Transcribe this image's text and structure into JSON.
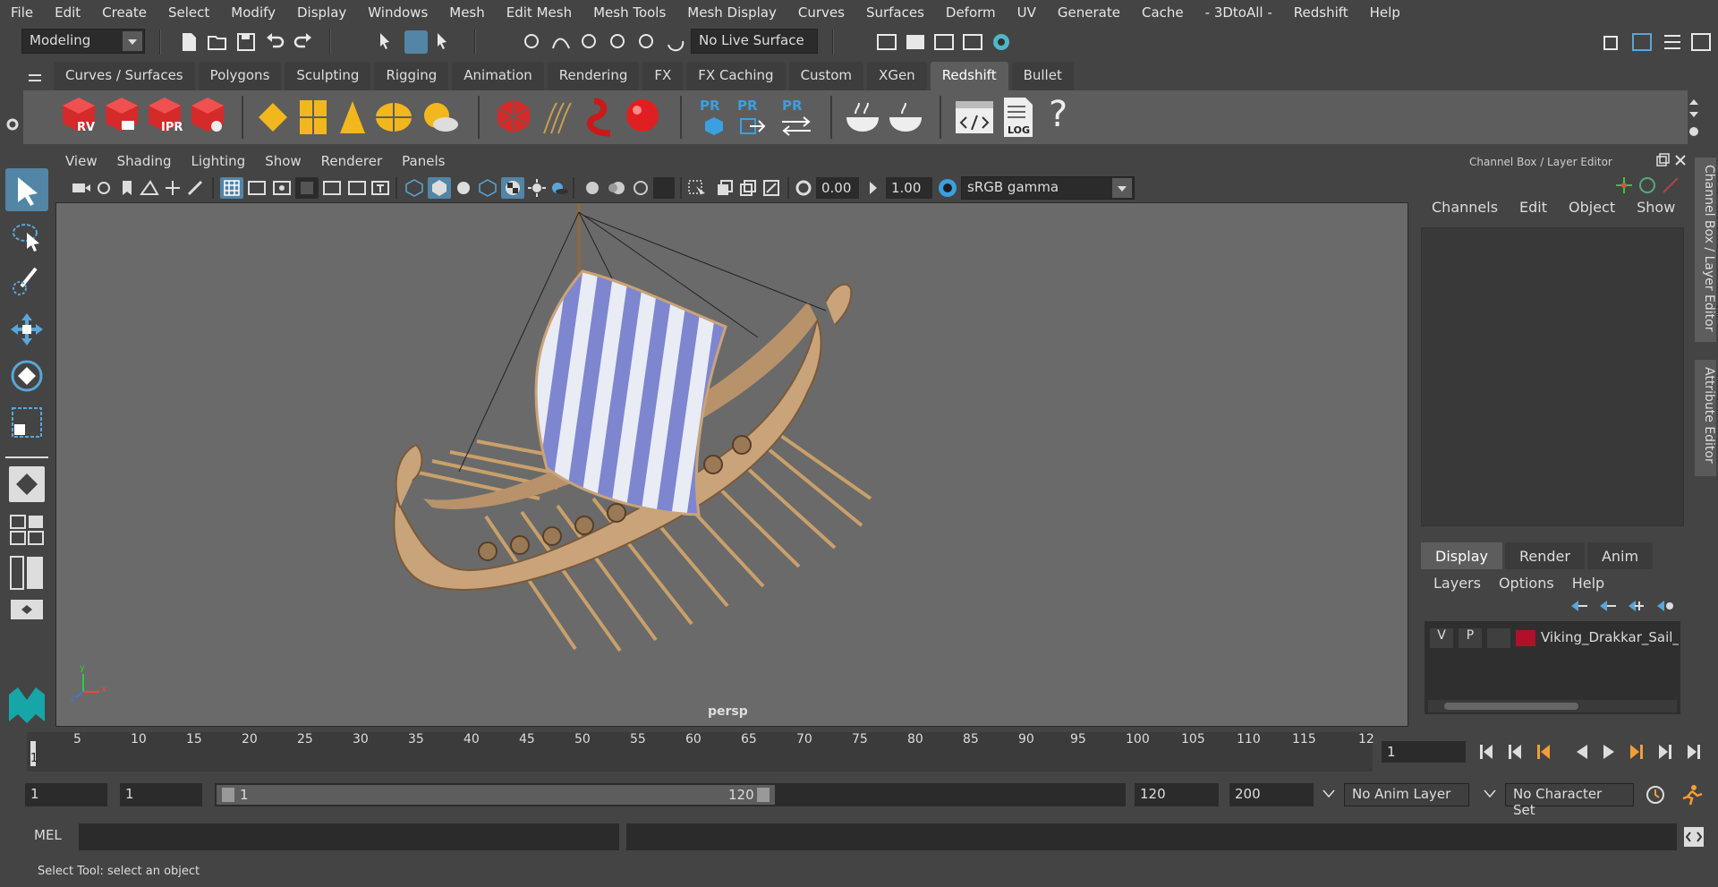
{
  "menubar": [
    "File",
    "Edit",
    "Create",
    "Select",
    "Modify",
    "Display",
    "Windows",
    "Mesh",
    "Edit Mesh",
    "Mesh Tools",
    "Mesh Display",
    "Curves",
    "Surfaces",
    "Deform",
    "UV",
    "Generate",
    "Cache",
    "- 3DtoAll -",
    "Redshift",
    "Help"
  ],
  "toolbar": {
    "mode": "Modeling",
    "live_surface": "No Live Surface"
  },
  "shelf_tabs": [
    "Curves / Surfaces",
    "Polygons",
    "Sculpting",
    "Rigging",
    "Animation",
    "Rendering",
    "FX",
    "FX Caching",
    "Custom",
    "XGen",
    "Redshift",
    "Bullet"
  ],
  "shelf_active": "Redshift",
  "shelf_icons": {
    "rv": "RV",
    "ipr": "IPR",
    "pr": "PR",
    "log": "LOG",
    "help": "?"
  },
  "viewport": {
    "menu": [
      "View",
      "Shading",
      "Lighting",
      "Show",
      "Renderer",
      "Panels"
    ],
    "exposure": "0.00",
    "gamma": "1.00",
    "colorspace": "sRGB gamma",
    "camera": "persp",
    "axis_x": "x",
    "axis_y": "y",
    "axis_z": "z"
  },
  "channel_box": {
    "title": "Channel Box / Layer Editor",
    "menu": [
      "Channels",
      "Edit",
      "Object",
      "Show"
    ]
  },
  "layer_editor": {
    "tabs": [
      "Display",
      "Render",
      "Anim"
    ],
    "active_tab": "Display",
    "menu": [
      "Layers",
      "Options",
      "Help"
    ],
    "layer": {
      "v": "V",
      "p": "P",
      "name": "Viking_Drakkar_Sail_Bl",
      "color": "#b0102a"
    }
  },
  "side_tabs": [
    "Channel Box / Layer Editor",
    "Attribute Editor"
  ],
  "timeline": {
    "ticks": [
      "5",
      "10",
      "15",
      "20",
      "25",
      "30",
      "35",
      "40",
      "45",
      "50",
      "55",
      "60",
      "65",
      "70",
      "75",
      "80",
      "85",
      "90",
      "95",
      "100",
      "105",
      "110",
      "115",
      "12"
    ],
    "current_marker": "1",
    "current_frame": "1"
  },
  "range": {
    "start": "1",
    "playback_start": "1",
    "slider_start": "1",
    "slider_end": "120",
    "playback_end": "120",
    "end": "200",
    "anim_layer": "No Anim Layer",
    "character_set": "No Character Set"
  },
  "mel": {
    "label": "MEL"
  },
  "help_line": "Select Tool: select an object"
}
